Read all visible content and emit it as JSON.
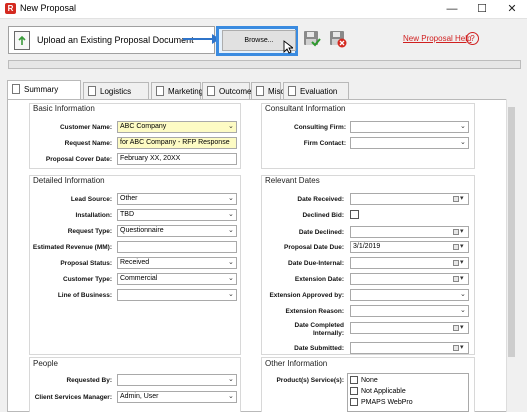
{
  "window": {
    "title": "New Proposal",
    "app_icon": "R",
    "minimize": "—",
    "maximize": "☐",
    "close": "✕"
  },
  "toolbar": {
    "upload_label": "Upload an Existing Proposal Document",
    "browse_label": "Browse...",
    "help_link": "New Proposal Help",
    "help_icon": "?"
  },
  "tabs": [
    {
      "label": "Summary",
      "active": true
    },
    {
      "label": "Logistics"
    },
    {
      "label": "Marketing"
    },
    {
      "label": "Outcome"
    },
    {
      "label": "Misc"
    },
    {
      "label": "Evaluation"
    }
  ],
  "basic": {
    "title": "Basic Information",
    "customer_name_label": "Customer Name:",
    "customer_name": "ABC Company",
    "request_name_label": "Request Name:",
    "request_name": "for ABC Company - RFP Response",
    "cover_date_label": "Proposal Cover Date:",
    "cover_date": "February XX, 20XX"
  },
  "consultant": {
    "title": "Consultant Information",
    "firm_label": "Consulting Firm:",
    "firm": "",
    "contact_label": "Firm Contact:",
    "contact": ""
  },
  "detailed": {
    "title": "Detailed Information",
    "lead_source_label": "Lead Source:",
    "lead_source": "Other",
    "installation_label": "Installation:",
    "installation": "TBD",
    "request_type_label": "Request Type:",
    "request_type": "Questionnaire",
    "est_revenue_label": "Estimated Revenue (MM):",
    "est_revenue": "",
    "status_label": "Proposal Status:",
    "status": "Received",
    "customer_type_label": "Customer Type:",
    "customer_type": "Commercial",
    "lob_label": "Line of Business:",
    "lob": ""
  },
  "dates": {
    "title": "Relevant Dates",
    "received_label": "Date Received:",
    "received": "",
    "declined_bid_label": "Declined Bid:",
    "declined_label": "Date Declined:",
    "declined": "",
    "due_label": "Proposal Date Due:",
    "due": "3/1/2019",
    "due_internal_label": "Date Due-Internal:",
    "due_internal": "",
    "ext_date_label": "Extension Date:",
    "ext_date": "",
    "ext_approved_label": "Extension Approved by:",
    "ext_approved": "",
    "ext_reason_label": "Extension Reason:",
    "ext_reason": "",
    "completed_label_1": "Date Completed",
    "completed_label_2": "Internally:",
    "completed": "",
    "submitted_label": "Date Submitted:",
    "submitted": ""
  },
  "people": {
    "title": "People",
    "requested_by_label": "Requested By:",
    "requested_by": "",
    "csm_label": "Client Services Manager:",
    "csm": "Admin, User"
  },
  "other": {
    "title": "Other Information",
    "products_label": "Product(s) Service(s):",
    "products": [
      "None",
      "Not Applicable",
      "PMAPS WebPro"
    ]
  },
  "colors": {
    "highlight": "#3a8be0",
    "required": "#fdfbc4",
    "help": "#d01f1f"
  }
}
